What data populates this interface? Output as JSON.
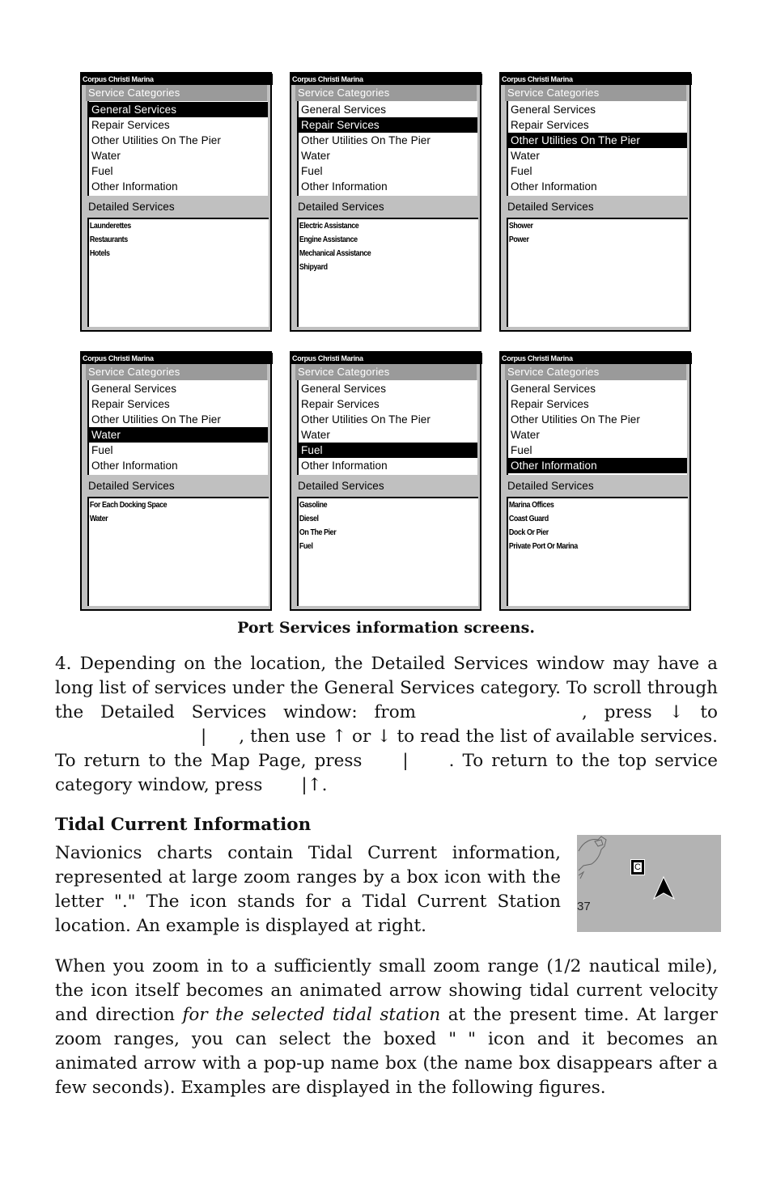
{
  "screens": [
    {
      "title": "Corpus Christi Marina",
      "categories_header": "Service Categories",
      "categories": [
        "General Services",
        "Repair Services",
        "Other Utilities On The Pier",
        "Water",
        "Fuel",
        "Other Information"
      ],
      "selected_index": 0,
      "detailed_header": "Detailed Services",
      "detailed": [
        "Launderettes",
        "Restaurants",
        "Hotels"
      ]
    },
    {
      "title": "Corpus Christi Marina",
      "categories_header": "Service Categories",
      "categories": [
        "General Services",
        "Repair Services",
        "Other Utilities On The Pier",
        "Water",
        "Fuel",
        "Other Information"
      ],
      "selected_index": 1,
      "detailed_header": "Detailed Services",
      "detailed": [
        "Electric Assistance",
        "Engine Assistance",
        "Mechanical Assistance",
        "Shipyard"
      ]
    },
    {
      "title": "Corpus Christi Marina",
      "categories_header": "Service Categories",
      "categories": [
        "General Services",
        "Repair Services",
        "Other Utilities On The Pier",
        "Water",
        "Fuel",
        "Other Information"
      ],
      "selected_index": 2,
      "detailed_header": "Detailed Services",
      "detailed": [
        "Shower",
        "Power"
      ]
    },
    {
      "title": "Corpus Christi Marina",
      "categories_header": "Service Categories",
      "categories": [
        "General Services",
        "Repair Services",
        "Other Utilities On The Pier",
        "Water",
        "Fuel",
        "Other Information"
      ],
      "selected_index": 3,
      "detailed_header": "Detailed Services",
      "detailed": [
        "For Each Docking Space",
        "Water"
      ]
    },
    {
      "title": "Corpus Christi Marina",
      "categories_header": "Service Categories",
      "categories": [
        "General Services",
        "Repair Services",
        "Other Utilities On The Pier",
        "Water",
        "Fuel",
        "Other Information"
      ],
      "selected_index": 4,
      "detailed_header": "Detailed Services",
      "detailed": [
        "Gasoline",
        "Diesel",
        "On The Pier",
        "Fuel"
      ]
    },
    {
      "title": "Corpus Christi Marina",
      "categories_header": "Service Categories",
      "categories": [
        "General Services",
        "Repair Services",
        "Other Utilities On The Pier",
        "Water",
        "Fuel",
        "Other Information"
      ],
      "selected_index": 5,
      "detailed_header": "Detailed Services",
      "detailed": [
        "Marina Offices",
        "Coast Guard",
        "Dock Or Pier",
        "Private Port Or Marina"
      ]
    }
  ],
  "caption": "Port Services information screens.",
  "step4": {
    "l1": "4. Depending on the location, the Detailed Services window may have a long list of services under the General Services category. To scroll through the Detailed Services window: from",
    "l2": ", press ↓ to",
    "l3": "|",
    "l4": ", then use ↑ or ↓ to read the list of available services. To return to the Map Page, press",
    "l5": "|",
    "l6": ". To return to the top service category window, press",
    "l7": "|↑."
  },
  "tidal": {
    "heading": "Tidal Current Information",
    "p1_a": "Navionics charts contain Tidal Current information, represented at large zoom ranges by a box icon with the letter \"",
    "p1_b": ".\" The icon stands for a Tidal Current Station location. An example is displayed at right.",
    "map_icon_letter": "C",
    "map_label": "37"
  },
  "zoom_para": {
    "a": "When you zoom in to a sufficiently small zoom range (1/2 nautical mile), the icon itself becomes an animated arrow showing tidal current velocity and direction",
    "italic": "for the selected tidal station",
    "b": "at the present time. At larger zoom ranges, you can select the boxed \"",
    "c": "\" icon and it becomes an animated arrow with a pop-up name box (the name box disappears after a few seconds). Examples are displayed in the following figures."
  }
}
